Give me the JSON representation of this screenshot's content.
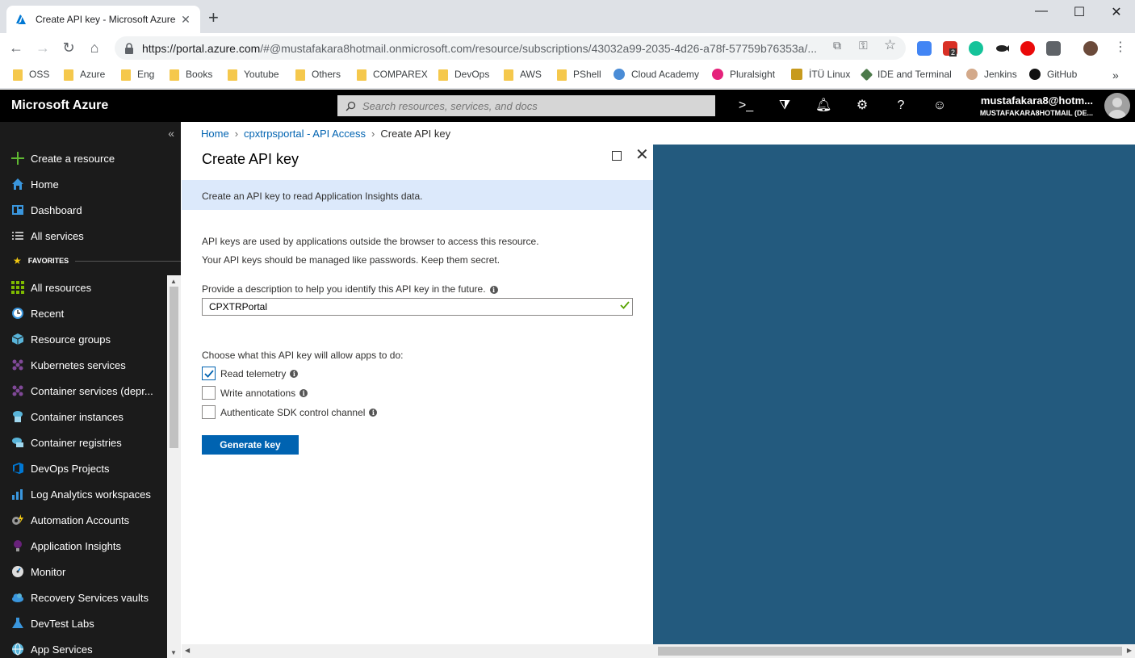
{
  "browser": {
    "tab_title": "Create API key - Microsoft Azure",
    "url_host": "https://portal.azure.com",
    "url_path": "/#@mustafakara8hotmail.onmicrosoft.com/resource/subscriptions/43032a99-2035-4d26-a78f-57759b76353a/...",
    "extension_badge": "2",
    "bookmarks": [
      "OSS",
      "Azure",
      "Eng",
      "Books",
      "Youtube",
      "Others",
      "COMPAREX",
      "DevOps",
      "AWS",
      "PShell",
      "Cloud Academy",
      "Pluralsight",
      "İTÜ Linux",
      "IDE and Terminal",
      "Jenkins",
      "GitHub"
    ]
  },
  "azure": {
    "brand": "Microsoft Azure",
    "search_placeholder": "Search resources, services, and docs",
    "account_name": "mustafakara8@hotm...",
    "account_dir": "MUSTAFAKARA8HOTMAIL (DE..."
  },
  "nav": {
    "create": "Create a resource",
    "home": "Home",
    "dashboard": "Dashboard",
    "all_services": "All services",
    "favorites_header": "FAVORITES",
    "favorites": [
      "All resources",
      "Recent",
      "Resource groups",
      "Kubernetes services",
      "Container services (depr...",
      "Container instances",
      "Container registries",
      "DevOps Projects",
      "Log Analytics workspaces",
      "Automation Accounts",
      "Application Insights",
      "Monitor",
      "Recovery Services vaults",
      "DevTest Labs",
      "App Services"
    ]
  },
  "breadcrumb": {
    "home": "Home",
    "parent": "cpxtrpsportal - API Access",
    "current": "Create API key"
  },
  "blade": {
    "title": "Create API key",
    "info": "Create an API key to read Application Insights data.",
    "para1": "API keys are used by applications outside the browser to access this resource.",
    "para2": "Your API keys should be managed like passwords. Keep them secret.",
    "desc_label": "Provide a description to help you identify this API key in the future.",
    "desc_value": "CPXTRPortal",
    "choose_label": "Choose what this API key will allow apps to do:",
    "options": [
      {
        "label": "Read telemetry",
        "checked": true
      },
      {
        "label": "Write annotations",
        "checked": false
      },
      {
        "label": "Authenticate SDK control channel",
        "checked": false
      }
    ],
    "generate_label": "Generate key"
  },
  "colors": {
    "azure_blue": "#0063b1",
    "info_bg": "#dce9fb",
    "right_pane": "#235a7e",
    "nav_bg": "#1b1b1b"
  }
}
